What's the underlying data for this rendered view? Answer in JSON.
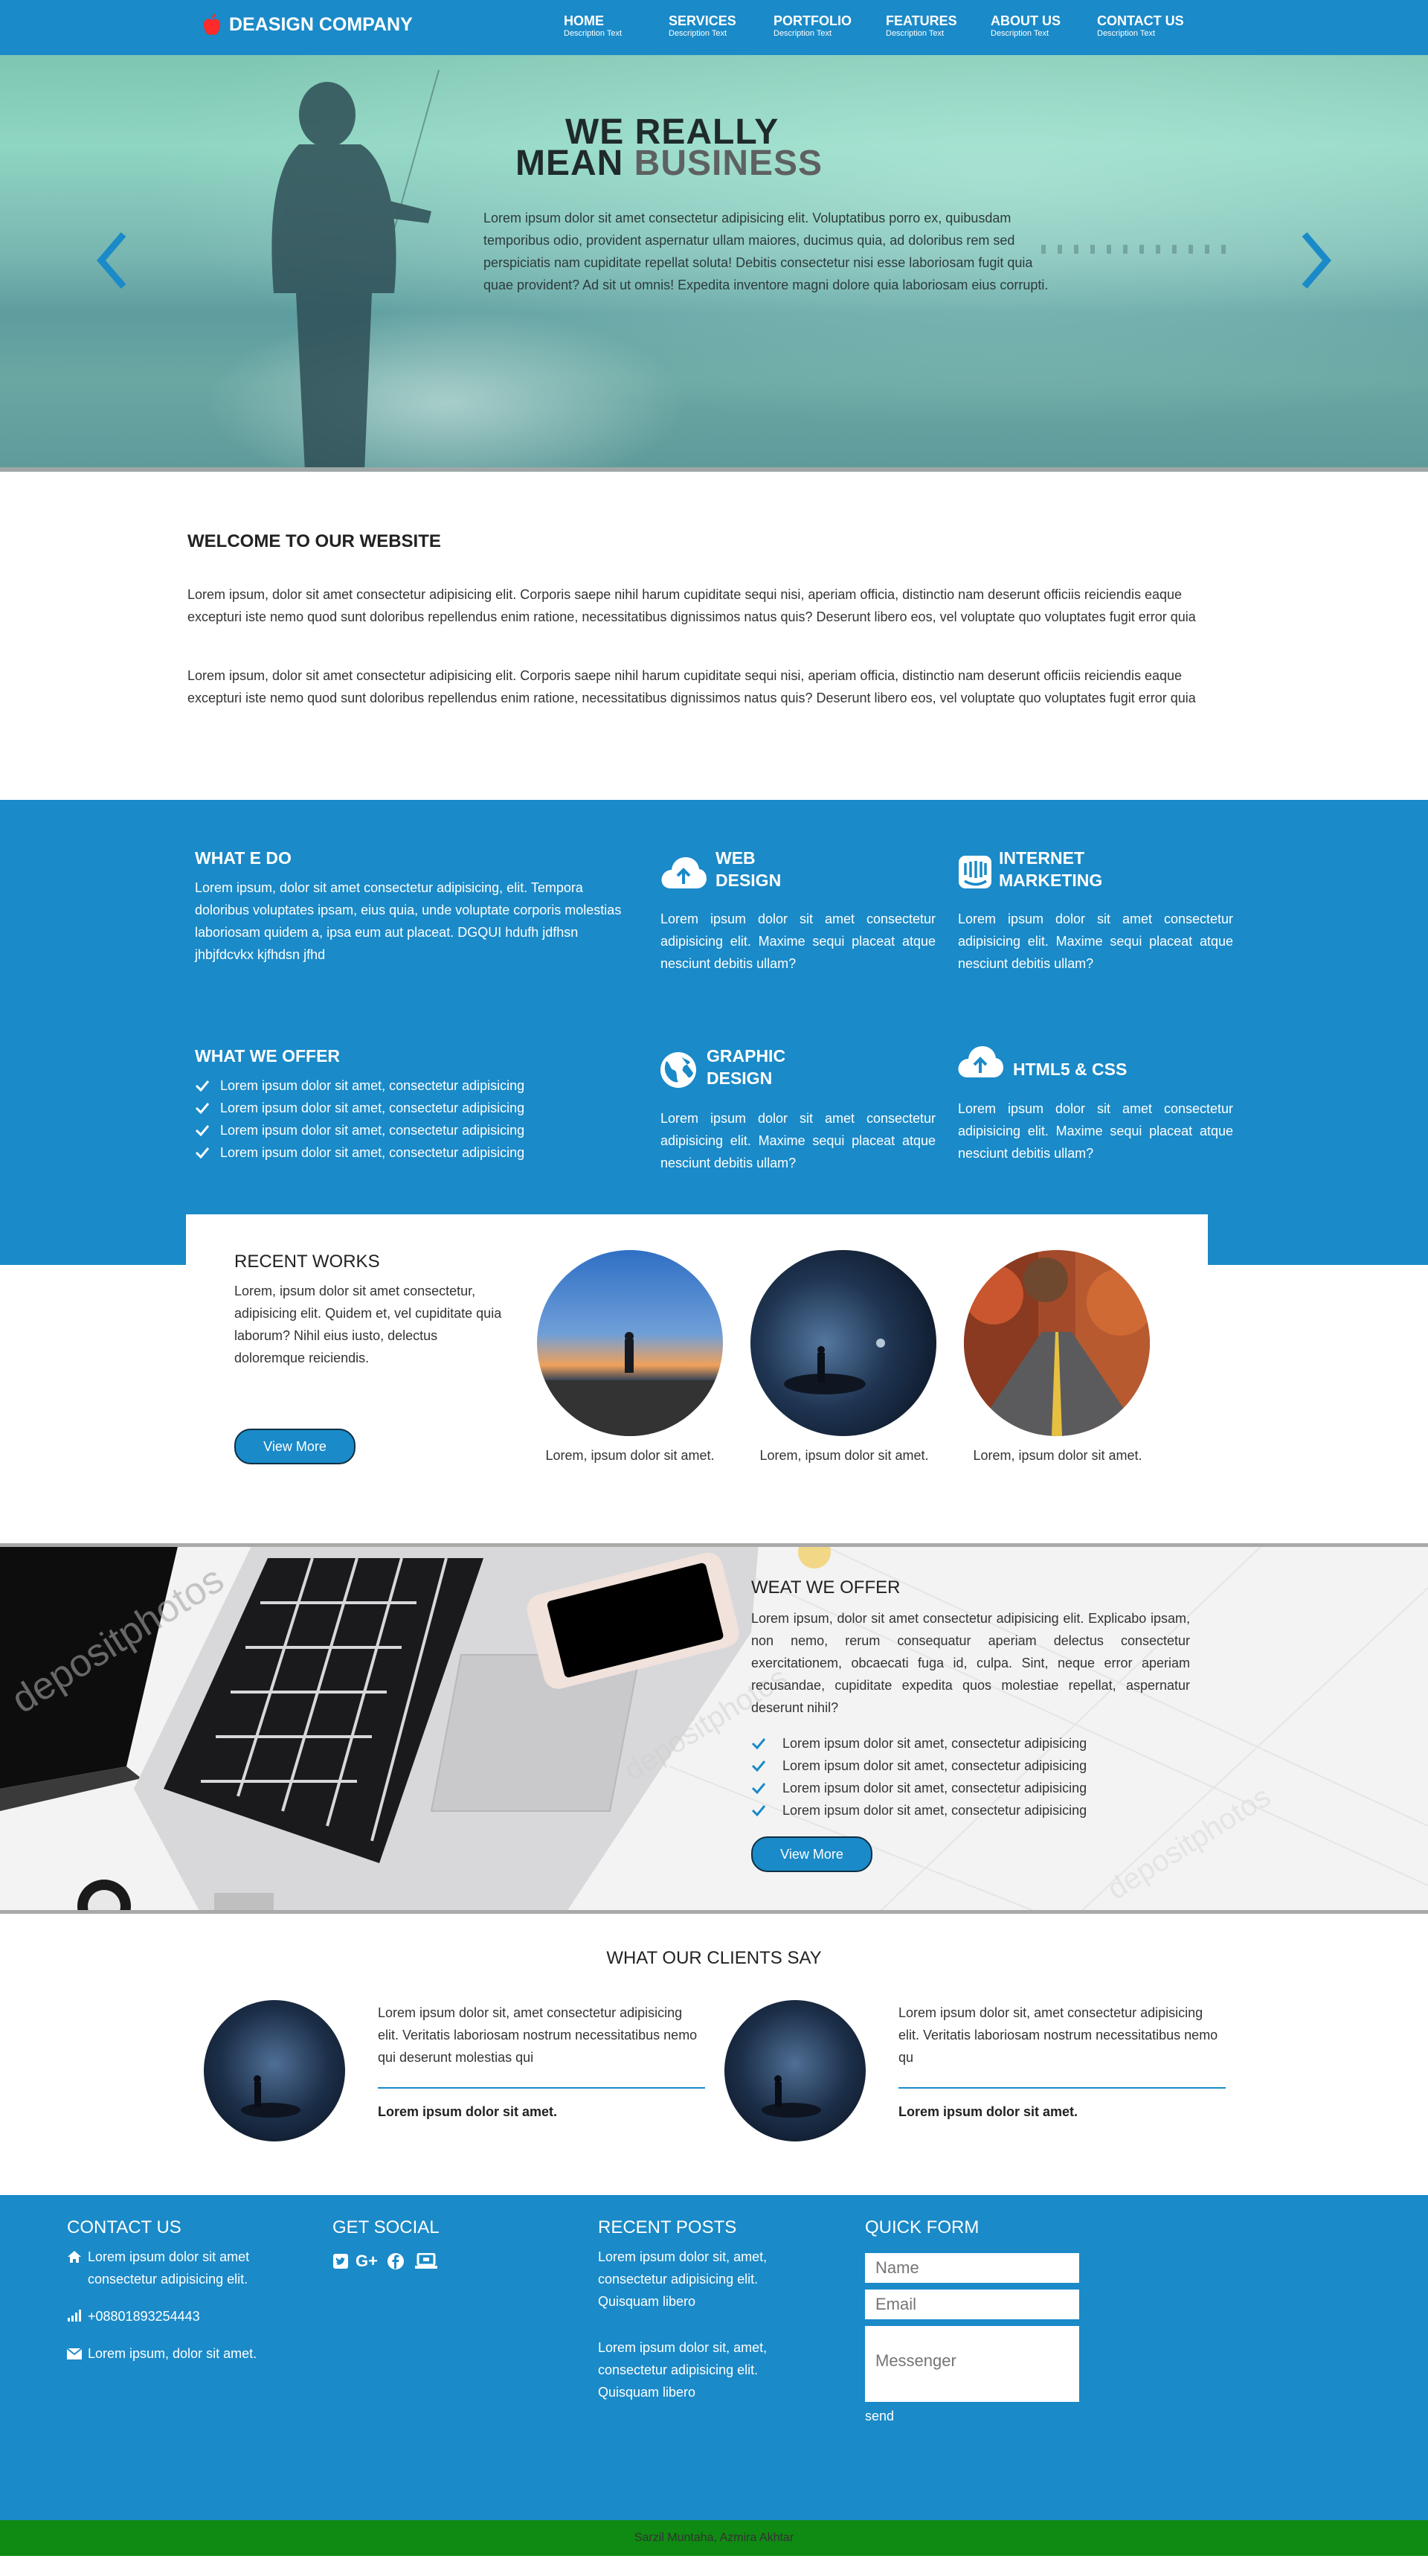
{
  "brand": {
    "name": "DEASIGN COMPANY",
    "logo_color": "#ff2a2a"
  },
  "nav": [
    {
      "label": "HOME",
      "sub": "Description Text"
    },
    {
      "label": "SERVICES",
      "sub": "Description Text"
    },
    {
      "label": "PORTFOLIO",
      "sub": "Description Text"
    },
    {
      "label": "FEATURES",
      "sub": "Description Text"
    },
    {
      "label": "ABOUT US",
      "sub": "Description Text"
    },
    {
      "label": "CONTACT US",
      "sub": "Description Text"
    }
  ],
  "hero": {
    "title_line1": "WE REALLY",
    "title_line2_a": "MEAN",
    "title_line2_b": "BUSINESS",
    "text": "Lorem ipsum dolor sit amet consectetur adipisicing elit. Voluptatibus porro ex, quibusdam temporibus odio, provident aspernatur ullam maiores, ducimus quia, ad doloribus rem sed perspiciatis nam cupiditate repellat soluta! Debitis consectetur nisi esse laboriosam fugit quia quae provident? Ad sit ut omnis! Expedita inventore magni dolore quia laboriosam eius corrupti."
  },
  "welcome": {
    "title": "WELCOME TO OUR WEBSITE",
    "p1": "Lorem ipsum, dolor sit amet consectetur adipisicing elit. Corporis saepe nihil harum cupiditate sequi nisi, aperiam officia, distinctio nam deserunt officiis reiciendis eaque excepturi iste nemo quod sunt doloribus repellendus enim ratione, necessitatibus dignissimos natus quis? Deserunt libero eos, vel voluptate quo voluptates fugit error quia",
    "p2": "Lorem ipsum, dolor sit amet consectetur adipisicing elit. Corporis saepe nihil harum cupiditate sequi nisi, aperiam officia, distinctio nam deserunt officiis reiciendis eaque excepturi iste nemo quod sunt doloribus repellendus enim ratione, necessitatibus dignissimos natus quis? Deserunt libero eos, vel voluptate quo voluptates fugit error quia"
  },
  "what_we_do": {
    "title": "WHAT E DO",
    "text": "Lorem ipsum, dolor sit amet consectetur adipisicing, elit. Tempora doloribus voluptates ipsam, eius quia, unde voluptate corporis molestias laboriosam quidem a, ipsa eum aut placeat. DGQUI hdufh jdfhsn jhbjfdcvkx kjfhdsn jfhd"
  },
  "what_we_offer": {
    "title": "WHAT WE OFFER",
    "items": [
      "Lorem ipsum dolor sit amet, consectetur adipisicing",
      "Lorem ipsum dolor sit amet, consectetur adipisicing",
      "Lorem ipsum dolor sit amet, consectetur adipisicing",
      "Lorem ipsum dolor sit amet, consectetur adipisicing"
    ]
  },
  "services": [
    {
      "title_a": "WEB",
      "title_b": "DESIGN",
      "icon": "cloud-upload-icon",
      "text": "Lorem ipsum dolor sit amet consectetur adipisicing elit. Maxime sequi placeat atque nesciunt debitis ullam?"
    },
    {
      "title_a": "INTERNET",
      "title_b": "MARKETING",
      "icon": "intercom-icon",
      "text": "Lorem ipsum dolor sit amet consectetur adipisicing elit. Maxime sequi placeat atque nesciunt debitis ullam?"
    },
    {
      "title_a": "GRAPHIC",
      "title_b": "DESIGN",
      "icon": "globe-icon",
      "text": "Lorem ipsum dolor sit amet consectetur adipisicing elit. Maxime sequi placeat atque nesciunt debitis ullam?"
    },
    {
      "title_a": "HTML5 & CSS",
      "title_b": "",
      "icon": "cloud-upload-icon",
      "text": "Lorem ipsum dolor sit amet consectetur adipisicing elit. Maxime sequi placeat atque nesciunt debitis ullam?"
    }
  ],
  "recent_works": {
    "title": "RECENT WORKS",
    "text": "Lorem, ipsum dolor sit amet consectetur, adipisicing elit. Quidem et, vel cupiditate quia laborum? Nihil eius iusto, delectus doloremque reiciendis.",
    "button": "View More",
    "items": [
      {
        "caption": "Lorem, ipsum dolor sit amet."
      },
      {
        "caption": "Lorem, ipsum dolor sit amet."
      },
      {
        "caption": "Lorem, ipsum dolor sit amet."
      }
    ]
  },
  "offer": {
    "title": "WEAT WE OFFER",
    "text": "Lorem ipsum, dolor sit amet consectetur adipisicing elit. Explicabo ipsam, non nemo, rerum consequatur aperiam delectus consectetur exercitationem, obcaecati fuga id, culpa. Sint, neque error aperiam recusandae, cupiditate expedita quos molestiae repellat, aspernatur deserunt nihil?",
    "items": [
      "Lorem ipsum dolor sit amet, consectetur adipisicing",
      "Lorem ipsum dolor sit amet, consectetur adipisicing",
      "Lorem ipsum dolor sit amet, consectetur adipisicing",
      "Lorem ipsum dolor sit amet, consectetur adipisicing"
    ],
    "button": "View More",
    "watermark": "depositphotos"
  },
  "clients": {
    "title": "WHAT OUR CLIENTS SAY",
    "items": [
      {
        "quote": "Lorem ipsum dolor sit, amet consectetur adipisicing elit. Veritatis laboriosam nostrum necessitatibus nemo qui deserunt molestias qui",
        "name": "Lorem ipsum dolor sit amet."
      },
      {
        "quote": "Lorem ipsum dolor sit, amet consectetur adipisicing elit. Veritatis laboriosam nostrum necessitatibus nemo qu",
        "name": "Lorem ipsum dolor sit amet."
      }
    ]
  },
  "footer": {
    "contact": {
      "title": "CONTACT US",
      "address": "Lorem ipsum dolor sit amet consectetur adipisicing elit.",
      "phone": "+08801893254443",
      "email": "Lorem ipsum, dolor sit amet."
    },
    "social": {
      "title": "GET SOCIAL",
      "icons": [
        "twitter-icon",
        "google-plus-icon",
        "facebook-icon",
        "laptop-icon"
      ]
    },
    "posts": {
      "title": "RECENT POSTS",
      "items": [
        "Lorem ipsum dolor sit, amet, consectetur adipisicing elit. Quisquam libero",
        "Lorem ipsum dolor sit, amet, consectetur adipisicing elit. Quisquam libero"
      ]
    },
    "form": {
      "title": "QUICK FORM",
      "name_placeholder": "Name",
      "email_placeholder": "Email",
      "message_placeholder": "Messenger",
      "send": "send"
    }
  },
  "copyright": "Sarzil Muntaha, Azmira Akhtar",
  "colors": {
    "primary": "#1a8ac8",
    "copyright_bar": "#0f8a12",
    "button_border": "#0f2f45"
  }
}
